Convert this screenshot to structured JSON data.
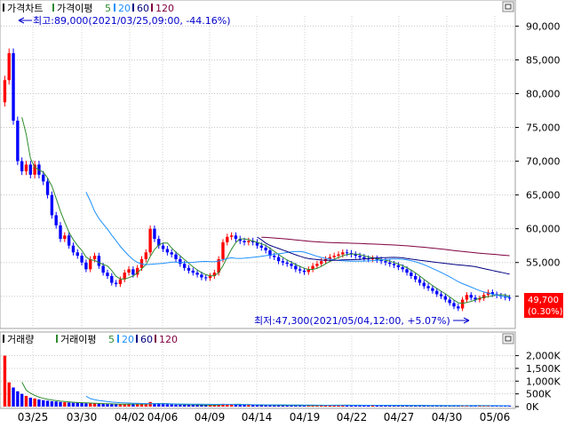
{
  "price_legend": {
    "title": "가격차트",
    "ma_label": "가격이평",
    "periods": [
      {
        "label": "5",
        "color": "#2e8b2e"
      },
      {
        "label": "20",
        "color": "#1e90ff"
      },
      {
        "label": "60",
        "color": "#000080"
      },
      {
        "label": "120",
        "color": "#800040"
      }
    ]
  },
  "volume_legend": {
    "title": "거래량",
    "ma_label": "거래이평",
    "periods": [
      {
        "label": "5",
        "color": "#2e8b2e"
      },
      {
        "label": "20",
        "color": "#1e90ff"
      },
      {
        "label": "60",
        "color": "#000080"
      },
      {
        "label": "120",
        "color": "#800040"
      }
    ]
  },
  "annotations": {
    "high": "최고:89,000(2021/03/25,09:00, -44.16%)",
    "low": "최저:47,300(2021/05/04,12:00, +5.07%)"
  },
  "current_price": {
    "value": "49,700",
    "change": "(0.30%)",
    "color": "#ff0000"
  },
  "colors": {
    "up": "#ff0000",
    "down": "#0000ff",
    "ma5": "#2e8b2e",
    "ma20": "#1e90ff",
    "ma60": "#000080",
    "ma120": "#800040"
  },
  "chart_data": {
    "type": "candlestick",
    "x_tick_labels": [
      "03/25",
      "03/30",
      "04/02",
      "04/06",
      "04/09",
      "04/14",
      "04/19",
      "04/22",
      "04/27",
      "04/30",
      "05/06"
    ],
    "price_axis": {
      "ticks": [
        "90,000",
        "85,000",
        "80,000",
        "75,000",
        "70,000",
        "65,000",
        "60,000",
        "55,000",
        "50,000"
      ],
      "ylim": [
        45500,
        91500
      ]
    },
    "volume_axis": {
      "ticks": [
        "2,000K",
        "1,500K",
        "1,000K",
        "500K",
        "0K"
      ],
      "ylim": [
        0,
        2300
      ]
    },
    "closes": [
      82000,
      86000,
      76000,
      70000,
      68500,
      69500,
      68000,
      69500,
      68000,
      67000,
      65000,
      62000,
      60500,
      58500,
      59000,
      57500,
      56500,
      56000,
      55000,
      54000,
      55500,
      56000,
      54500,
      53500,
      53000,
      52000,
      51800,
      52500,
      53500,
      54000,
      53200,
      54200,
      55500,
      56500,
      60000,
      58500,
      57500,
      57000,
      56500,
      56200,
      55500,
      54800,
      54200,
      53800,
      53500,
      53200,
      52800,
      52700,
      53000,
      53500,
      55500,
      58000,
      58800,
      59000,
      58500,
      58200,
      58000,
      58200,
      58000,
      57500,
      57200,
      56800,
      56000,
      55800,
      55200,
      55000,
      54800,
      54500,
      54000,
      53800,
      53600,
      54000,
      54500,
      54800,
      55200,
      55500,
      55800,
      56000,
      56200,
      56500,
      56400,
      56200,
      56000,
      55800,
      55600,
      55500,
      55600,
      55400,
      55200,
      55000,
      54800,
      54600,
      54300,
      54000,
      53500,
      53000,
      52500,
      52000,
      51500,
      51200,
      50800,
      50300,
      50000,
      49500,
      49000,
      48500,
      48200,
      49500,
      50200,
      49800,
      49500,
      49700,
      50200,
      50600,
      50300,
      50100,
      50000,
      49800,
      49700
    ],
    "volumes_k": [
      2000,
      950,
      750,
      600,
      500,
      420,
      350,
      320,
      280,
      250,
      230,
      210,
      200,
      180,
      170,
      160,
      150,
      150,
      140,
      130,
      125,
      120,
      115,
      110,
      100,
      95,
      90,
      95,
      100,
      110,
      105,
      100,
      95,
      100,
      180,
      120,
      110,
      100,
      90,
      85,
      80,
      75,
      70,
      70,
      65,
      60,
      60,
      58,
      60,
      62,
      90,
      110,
      95,
      85,
      80,
      75,
      70,
      65,
      65,
      60,
      58,
      56,
      55,
      54,
      52,
      50,
      50,
      48,
      47,
      46,
      45,
      46,
      48,
      50,
      52,
      55,
      56,
      58,
      60,
      58,
      56,
      55,
      54,
      53,
      52,
      50,
      50,
      49,
      48,
      47,
      46,
      45,
      44,
      43,
      42,
      41,
      40,
      40,
      39,
      38,
      37,
      36,
      36,
      35,
      34,
      34,
      35,
      40,
      38,
      36,
      35,
      34,
      36,
      38,
      36,
      35,
      34,
      33,
      32
    ]
  }
}
